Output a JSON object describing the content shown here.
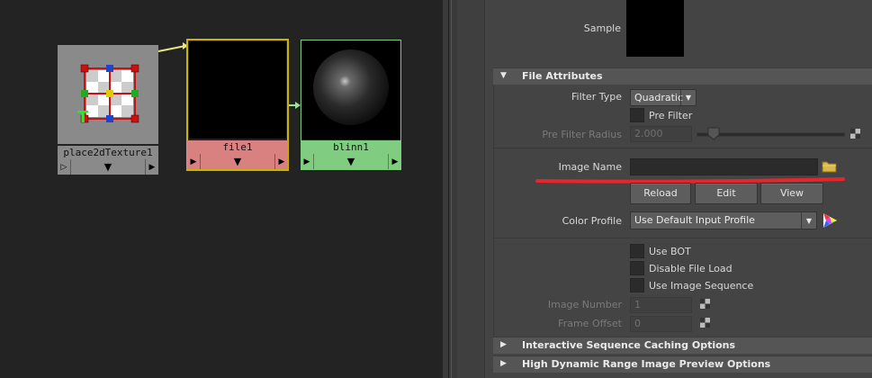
{
  "graph": {
    "nodes": [
      {
        "label": "place2dTexture1",
        "type": "place2dTexture",
        "down_icon": "▼",
        "in_icon": "▷",
        "out_icon": "▶"
      },
      {
        "label": "file1",
        "type": "file",
        "down_icon": "▼",
        "in_icon": "▶",
        "out_icon": "▶"
      },
      {
        "label": "blinn1",
        "type": "blinn",
        "down_icon": "▼",
        "in_icon": "▶",
        "out_icon": "▶"
      }
    ],
    "colors": {
      "file_label": "#d98080",
      "blinn_label": "#80cc80",
      "selected_border": "#c8b400",
      "connection": "#e8e87a"
    }
  },
  "attribute_editor": {
    "sample_label": "Sample",
    "file_attributes": {
      "title": "File Attributes",
      "filter_type_label": "Filter Type",
      "filter_type_value": "Quadratic",
      "pre_filter_label": "Pre Filter",
      "pre_filter_radius_label": "Pre Filter Radius",
      "pre_filter_radius_value": "2.000",
      "image_name_label": "Image Name",
      "image_name_value": "",
      "reload_label": "Reload",
      "edit_label": "Edit",
      "view_label": "View",
      "color_profile_label": "Color Profile",
      "color_profile_value": "Use Default Input Profile",
      "use_bot_label": "Use BOT",
      "disable_file_load_label": "Disable File Load",
      "use_image_sequence_label": "Use Image Sequence",
      "image_number_label": "Image Number",
      "image_number_value": "1",
      "frame_offset_label": "Frame Offset",
      "frame_offset_value": "0"
    },
    "collapsed_sections": [
      {
        "title": "Interactive Sequence Caching Options"
      },
      {
        "title": "High Dynamic Range Image Preview Options"
      }
    ],
    "annotation_color": "#e8262a"
  }
}
